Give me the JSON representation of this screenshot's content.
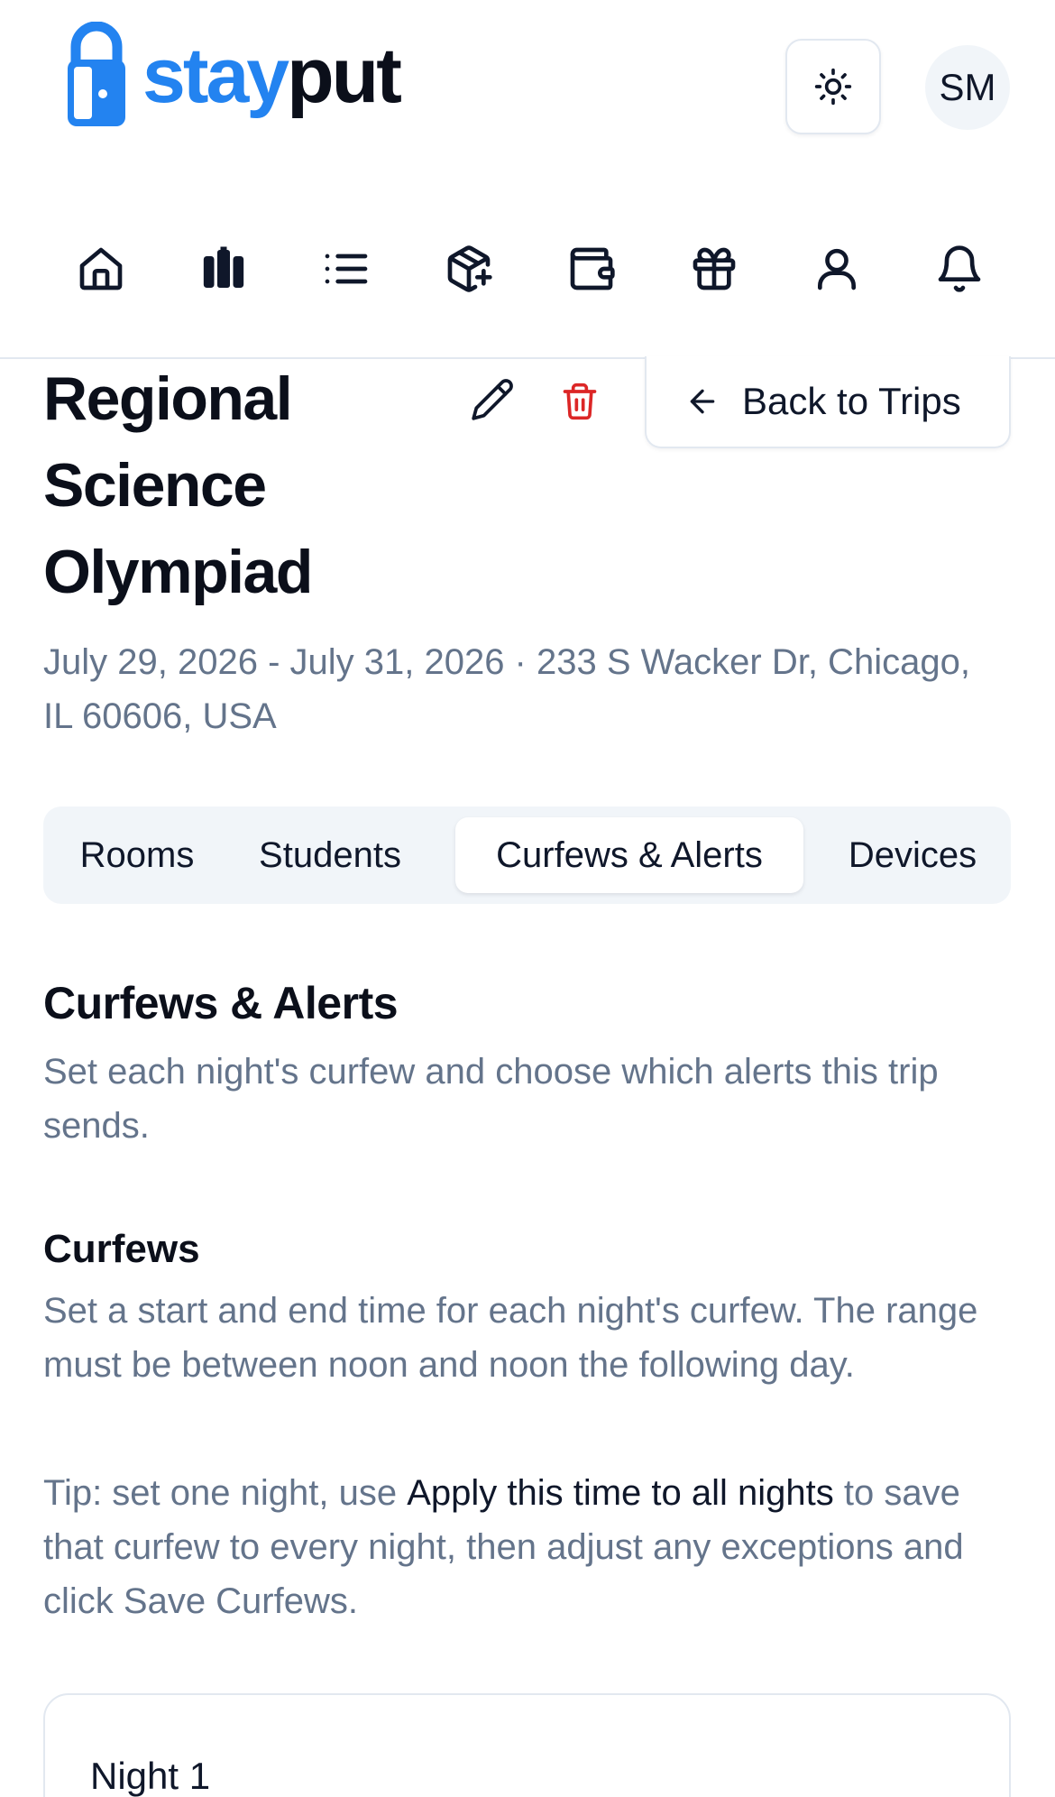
{
  "app": {
    "brand_stay": "stay",
    "brand_put": "put"
  },
  "header": {
    "avatar_initials": "SM",
    "theme_icon": "sun-icon"
  },
  "nav": {
    "items": [
      {
        "icon": "home-icon"
      },
      {
        "icon": "luggage-icon"
      },
      {
        "icon": "list-icon"
      },
      {
        "icon": "package-plus-icon"
      },
      {
        "icon": "wallet-icon"
      },
      {
        "icon": "gift-icon"
      },
      {
        "icon": "user-icon"
      },
      {
        "icon": "bell-icon"
      }
    ]
  },
  "trip": {
    "title_lines": [
      "Regional",
      "Science",
      "Olympiad"
    ],
    "meta": "July 29, 2026 - July 31, 2026 · 233 S Wacker Dr, Chicago, IL 60606, USA",
    "back_label": "Back to Trips"
  },
  "tabs": [
    {
      "label": "Rooms",
      "active": false
    },
    {
      "label": "Students",
      "active": false
    },
    {
      "label": "Curfews & Alerts",
      "active": true
    },
    {
      "label": "Devices",
      "active": false
    }
  ],
  "section": {
    "title": "Curfews & Alerts",
    "subtitle": "Set each night's curfew and choose which alerts this trip sends."
  },
  "curfews": {
    "title": "Curfews",
    "description": "Set a start and end time for each night's curfew. The range must be between noon and noon the following day.",
    "tip_prefix": "Tip: set one night, use ",
    "tip_bold": "Apply this time to all nights",
    "tip_suffix": " to save that curfew to every night, then adjust any exceptions and click Save Curfews.",
    "nights": [
      {
        "label": "Night 1"
      }
    ]
  },
  "colors": {
    "brand_blue": "#2383f0",
    "danger_red": "#dc2626",
    "muted_text": "#64748b"
  }
}
